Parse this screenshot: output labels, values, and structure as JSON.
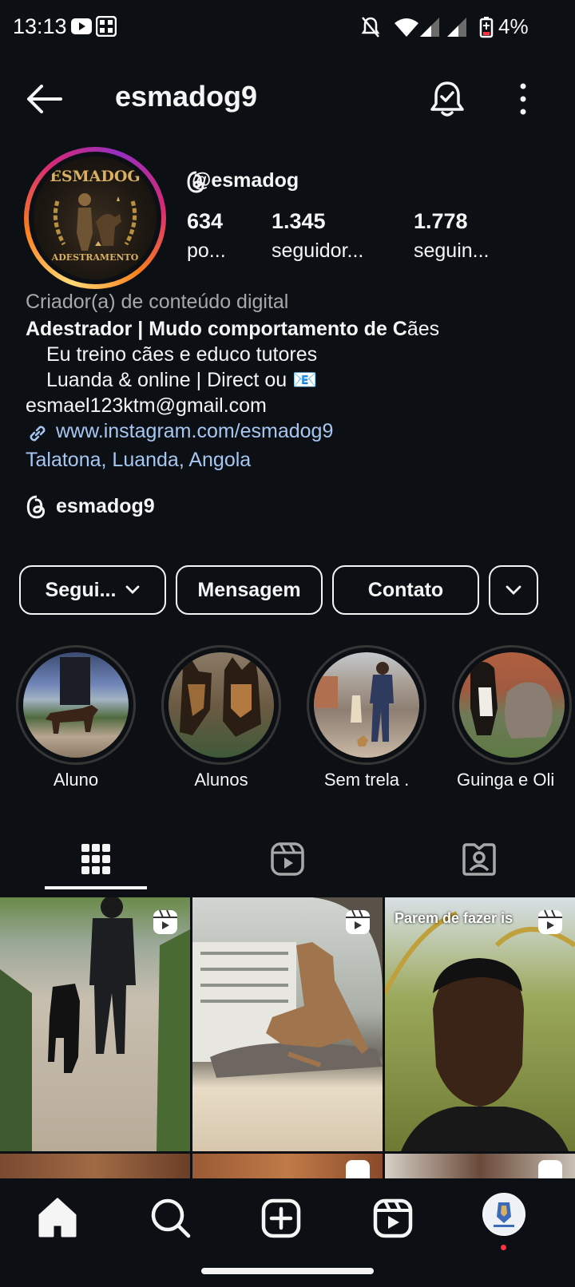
{
  "status_bar": {
    "time": "13:13",
    "battery": "4%"
  },
  "header": {
    "username": "esmadog9"
  },
  "profile": {
    "logo_top": "ESMADOG",
    "logo_bottom": "ADESTRAMENTO",
    "threads_handle": "@esmadog",
    "stats": [
      {
        "value": "634",
        "label": "po..."
      },
      {
        "value": "1.345",
        "label": "seguidor..."
      },
      {
        "value": "1.778",
        "label": "seguin..."
      }
    ],
    "category": "Criador(a) de conteúdo digital",
    "bio_bold": "Adestrador | Mudo comportamento de C",
    "bio_tail": "ães",
    "bio_line2": "Eu treino cães e educo tutores",
    "bio_line3": "Luanda & online | Direct ou",
    "bio_emoji": "📧",
    "email": "esmael123ktm@gmail.com",
    "website": "www.instagram.com/esmadog9",
    "location": "Talatona, Luanda, Angola",
    "threads_link": "esmadog9"
  },
  "buttons": {
    "following": "Segui...",
    "message": "Mensagem",
    "contact": "Contato"
  },
  "highlights": [
    {
      "label": "Aluno"
    },
    {
      "label": "Alunos"
    },
    {
      "label": "Sem trela ."
    },
    {
      "label": "Guinga e Oli"
    }
  ],
  "grid": {
    "post3_caption": "Parem de fazer is"
  },
  "colors": {
    "background": "#0c1014",
    "link": "#a6c7f2",
    "muted": "#a8a8a8",
    "notification_dot": "#ff3040"
  }
}
